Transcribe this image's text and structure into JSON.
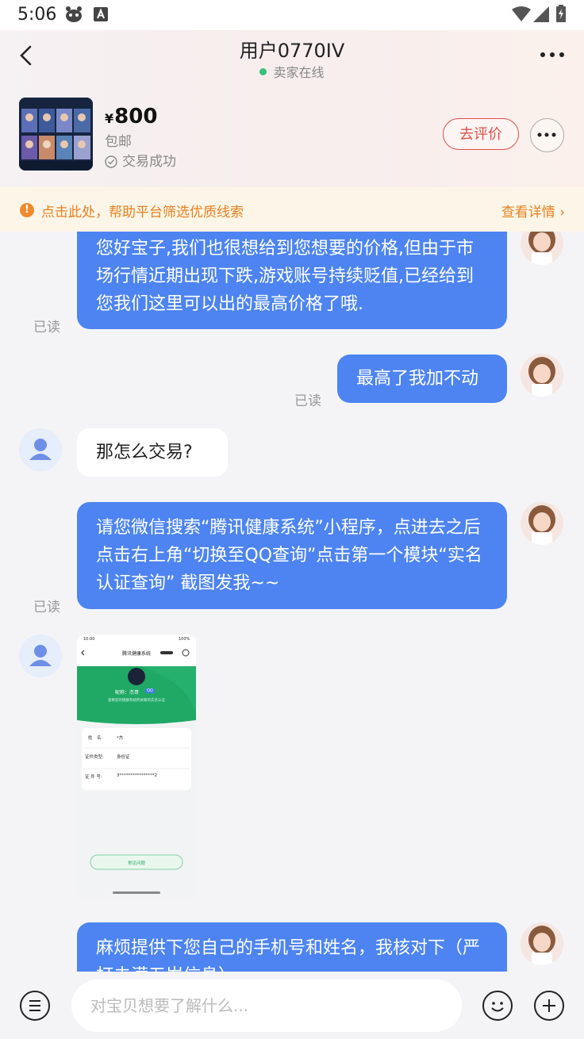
{
  "status_bar": {
    "time": "5:06"
  },
  "header": {
    "title": "用户0770IV",
    "online_status": "卖家在线",
    "back_icon": "chevron-left-icon",
    "more_icon": "more-dots-icon"
  },
  "item": {
    "currency": "¥",
    "price": "800",
    "shipping": "包邮",
    "deal_status": "交易成功",
    "review_button": "去评价"
  },
  "notice": {
    "text": "点击此处，帮助平台筛选优质线索",
    "link": "查看详情 ›"
  },
  "messages": [
    {
      "from": "me",
      "text": "您好宝子,我们也很想给到您想要的价格,但由于市场行情近期出现下跌,游戏账号持续贬值,已经给到您我们这里可以出的最高价格了哦.",
      "status": "已读"
    },
    {
      "from": "me",
      "text": "最高了我加不动",
      "status": "已读"
    },
    {
      "from": "peer",
      "text": "那怎么交易?"
    },
    {
      "from": "me",
      "text": "请您微信搜索“腾讯健康系统”小程序，点进去之后点击右上角“切换至QQ查询”点击第一个模块“实名认证查询” 截图发我~~",
      "status": "已读"
    },
    {
      "from": "peer",
      "type": "image"
    },
    {
      "from": "me",
      "text": "麻烦提供下您自己的手机号和姓名，我核对下（严打未满五岁信息）"
    }
  ],
  "screenshot_image": {
    "time": "10:00",
    "battery": "100%",
    "title": "腾讯健康系统",
    "nickname": "昵称：",
    "nickname_value": "杰哥",
    "badge": "QQ",
    "caption": "查看您的健康系统所关联的实名认证",
    "rows": [
      {
        "label": "姓　名:",
        "value": "*杰"
      },
      {
        "label": "证件类型:",
        "value": "身份证"
      },
      {
        "label": "证 件 号:",
        "value": "3****************2"
      }
    ],
    "faq_button": "常见问题"
  },
  "composer": {
    "placeholder": "对宝贝想要了解什么..."
  },
  "colors": {
    "bubble_mine": "#4d84f2",
    "accent_red": "#e0504a",
    "notice_orange": "#e8801f",
    "online_green": "#36c07a"
  }
}
